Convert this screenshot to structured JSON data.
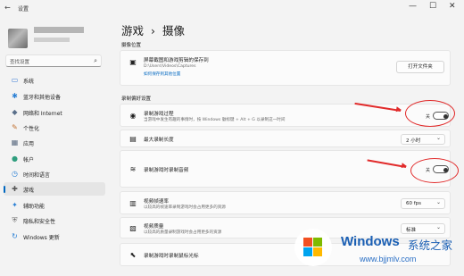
{
  "window": {
    "title": "设置",
    "back_icon": "back-arrow-icon",
    "controls": [
      "—",
      "☐",
      "✕"
    ]
  },
  "sidebar": {
    "search_placeholder": "查找设置",
    "items": [
      {
        "label": "系统",
        "icon": "monitor-icon",
        "glyph": "▭",
        "color": "#3a7bd5"
      },
      {
        "label": "蓝牙和其他设备",
        "icon": "bluetooth-icon",
        "glyph": "✱",
        "color": "#2a7fd4"
      },
      {
        "label": "网络和 Internet",
        "icon": "wifi-icon",
        "glyph": "◆",
        "color": "#5a6f8a"
      },
      {
        "label": "个性化",
        "icon": "brush-icon",
        "glyph": "✎",
        "color": "#c07030"
      },
      {
        "label": "应用",
        "icon": "apps-icon",
        "glyph": "▦",
        "color": "#5a6a80"
      },
      {
        "label": "帐户",
        "icon": "person-icon",
        "glyph": "●",
        "color": "#2f9e7e"
      },
      {
        "label": "时间和语言",
        "icon": "clock-globe-icon",
        "glyph": "◷",
        "color": "#2a7fd4"
      },
      {
        "label": "游戏",
        "icon": "gamepad-icon",
        "glyph": "✚",
        "color": "#555555",
        "selected": true
      },
      {
        "label": "辅助功能",
        "icon": "accessibility-icon",
        "glyph": "✦",
        "color": "#2a7fd4"
      },
      {
        "label": "隐私和安全性",
        "icon": "shield-icon",
        "glyph": "⛨",
        "color": "#707070"
      },
      {
        "label": "Windows 更新",
        "icon": "update-icon",
        "glyph": "↻",
        "color": "#2a7fd4"
      }
    ]
  },
  "breadcrumb": {
    "parent": "游戏",
    "separator": "›",
    "current": "摄像"
  },
  "capture_location": {
    "section_label": "摄像位置",
    "title": "屏幕截图和游戏剪辑的保存到",
    "path": "D:\\Users\\Videos\\Captures",
    "link": "如何保存到其他位置",
    "button": "打开文件夹",
    "icon": "folder-icon"
  },
  "recording_prefs": {
    "section_label": "录制偏好设置",
    "rows": [
      {
        "title": "录制游戏过程",
        "subtitle": "当游戏中发生有趣的事情时，按 Windows 徽标键 + Alt + G 以录制这一时间",
        "icon": "record-icon",
        "control": "toggle",
        "value": "关"
      },
      {
        "title": "最大录制长度",
        "subtitle": "",
        "icon": "timer-icon",
        "control": "dropdown",
        "value": "2 小时"
      },
      {
        "title": "录制游戏时录制音频",
        "subtitle": "",
        "icon": "audio-wave-icon",
        "control": "toggle",
        "value": "关"
      },
      {
        "title": "视频帧速率",
        "subtitle": "以较高的帧速率录制游戏时会占用更多的资源",
        "icon": "fps-icon",
        "control": "dropdown",
        "value": "60 fps"
      },
      {
        "title": "视频质量",
        "subtitle": "以较高的质量录制游戏时会占用更多的资源",
        "icon": "quality-icon",
        "control": "dropdown",
        "value": "标准"
      },
      {
        "title": "录制游戏时录制鼠标光标",
        "subtitle": "",
        "icon": "cursor-icon",
        "control": "none",
        "value": ""
      }
    ]
  },
  "watermark": {
    "brand": "Windows",
    "suffix": "系统之家",
    "url": "www.bjjmlv.com"
  },
  "colors": {
    "accent": "#0067c0",
    "annotation": "#e12a2a",
    "watermark": "#1a5fb4"
  }
}
